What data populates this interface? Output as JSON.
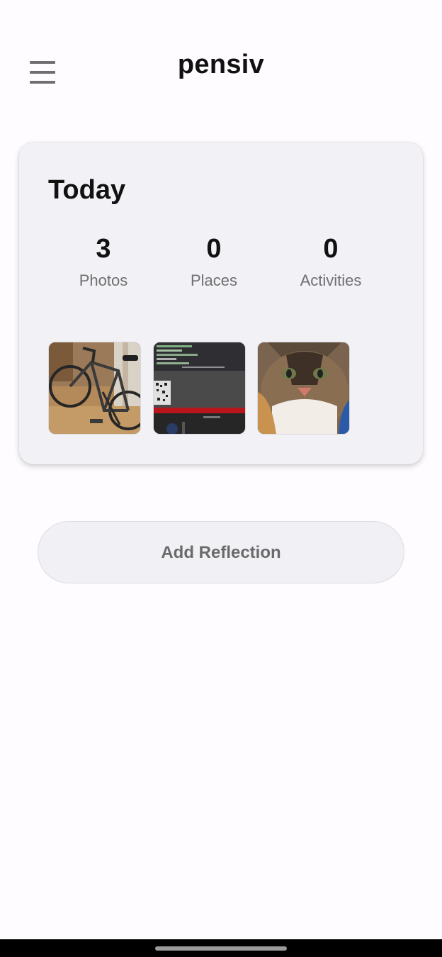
{
  "app": {
    "title": "pensiv",
    "menu_icon": "hamburger-menu-icon"
  },
  "today": {
    "title": "Today",
    "stats": [
      {
        "value": "3",
        "label": "Photos"
      },
      {
        "value": "0",
        "label": "Places"
      },
      {
        "value": "0",
        "label": "Activities"
      }
    ],
    "photos": [
      {
        "subject": "bicycle"
      },
      {
        "subject": "computer-screen"
      },
      {
        "subject": "cat"
      }
    ]
  },
  "actions": {
    "add_reflection_label": "Add Reflection"
  },
  "colors": {
    "card_background": "#f1f1f6",
    "button_background": "#f1f0f5",
    "title_text": "#111111",
    "secondary_text": "#707070"
  }
}
